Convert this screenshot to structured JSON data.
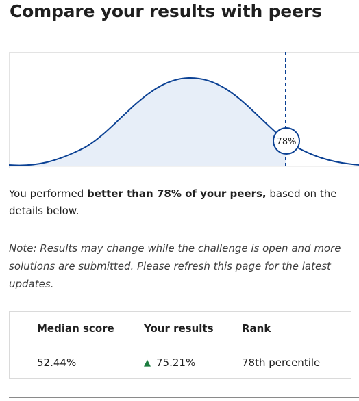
{
  "page": {
    "title": "Compare your results with peers"
  },
  "chart": {
    "marker_label": "78%",
    "percentile": 78,
    "line_color": "#0b4194",
    "fill_color": "#e7eef8"
  },
  "summary": {
    "prefix": "You performed ",
    "bold": "better than 78% of your peers,",
    "suffix": " based on the details below."
  },
  "note": {
    "text": "Note: Results may change while the challenge is open and more solutions are submitted. Please refresh this page for the latest updates."
  },
  "results_table": {
    "headers": [
      "Median score",
      "Your results",
      "Rank"
    ],
    "values": {
      "median": "52.44%",
      "your_results": "75.21%",
      "your_results_icon": "arrow-up-icon",
      "rank": "78th percentile"
    },
    "accent_color": "#1b7c3e"
  }
}
